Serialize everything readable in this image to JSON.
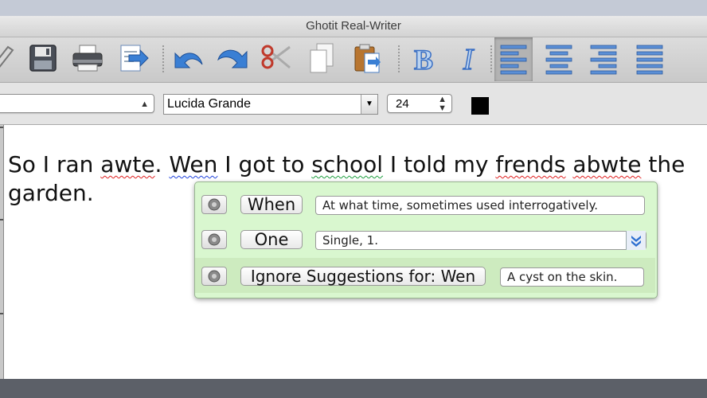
{
  "window": {
    "title": "Ghotit Real-Writer"
  },
  "toolbar": {
    "buttons": [
      {
        "name": "speak-icon"
      },
      {
        "name": "save-icon"
      },
      {
        "name": "print-icon"
      },
      {
        "name": "export-icon"
      },
      {
        "name": "undo-icon"
      },
      {
        "name": "redo-icon"
      },
      {
        "name": "cut-icon"
      },
      {
        "name": "copy-icon"
      },
      {
        "name": "paste-icon"
      },
      {
        "name": "bold-icon",
        "label": "B"
      },
      {
        "name": "italic-icon",
        "label": "I"
      },
      {
        "name": "align-left-icon"
      },
      {
        "name": "align-center-icon"
      },
      {
        "name": "align-right-icon"
      },
      {
        "name": "justify-icon"
      }
    ],
    "accent_color": "#3a6fc4"
  },
  "format": {
    "style_value": "",
    "font_family": "Lucida Grande",
    "font_size": "24",
    "text_color": "#000000"
  },
  "document": {
    "line1": [
      {
        "text": "So I ran ",
        "style": ""
      },
      {
        "text": "awte",
        "style": "red"
      },
      {
        "text": ". ",
        "style": ""
      },
      {
        "text": "Wen",
        "style": "blue"
      },
      {
        "text": " I got to ",
        "style": ""
      },
      {
        "text": "school",
        "style": "green"
      },
      {
        "text": " I told my ",
        "style": ""
      },
      {
        "text": "frends",
        "style": "red"
      },
      {
        "text": " ",
        "style": ""
      },
      {
        "text": "abwte",
        "style": "red"
      },
      {
        "text": " the",
        "style": ""
      }
    ],
    "line2": "garden."
  },
  "suggestions": {
    "items": [
      {
        "word": "When",
        "definition": "At what time, sometimes used interrogatively."
      },
      {
        "word": "One",
        "definition": "Single, 1."
      },
      {
        "word": "Ignore Suggestions for:  Wen",
        "definition": "A cyst on the skin."
      }
    ],
    "colors": {
      "background": "#d9f7cf",
      "highlight": "#cdebbf"
    }
  }
}
